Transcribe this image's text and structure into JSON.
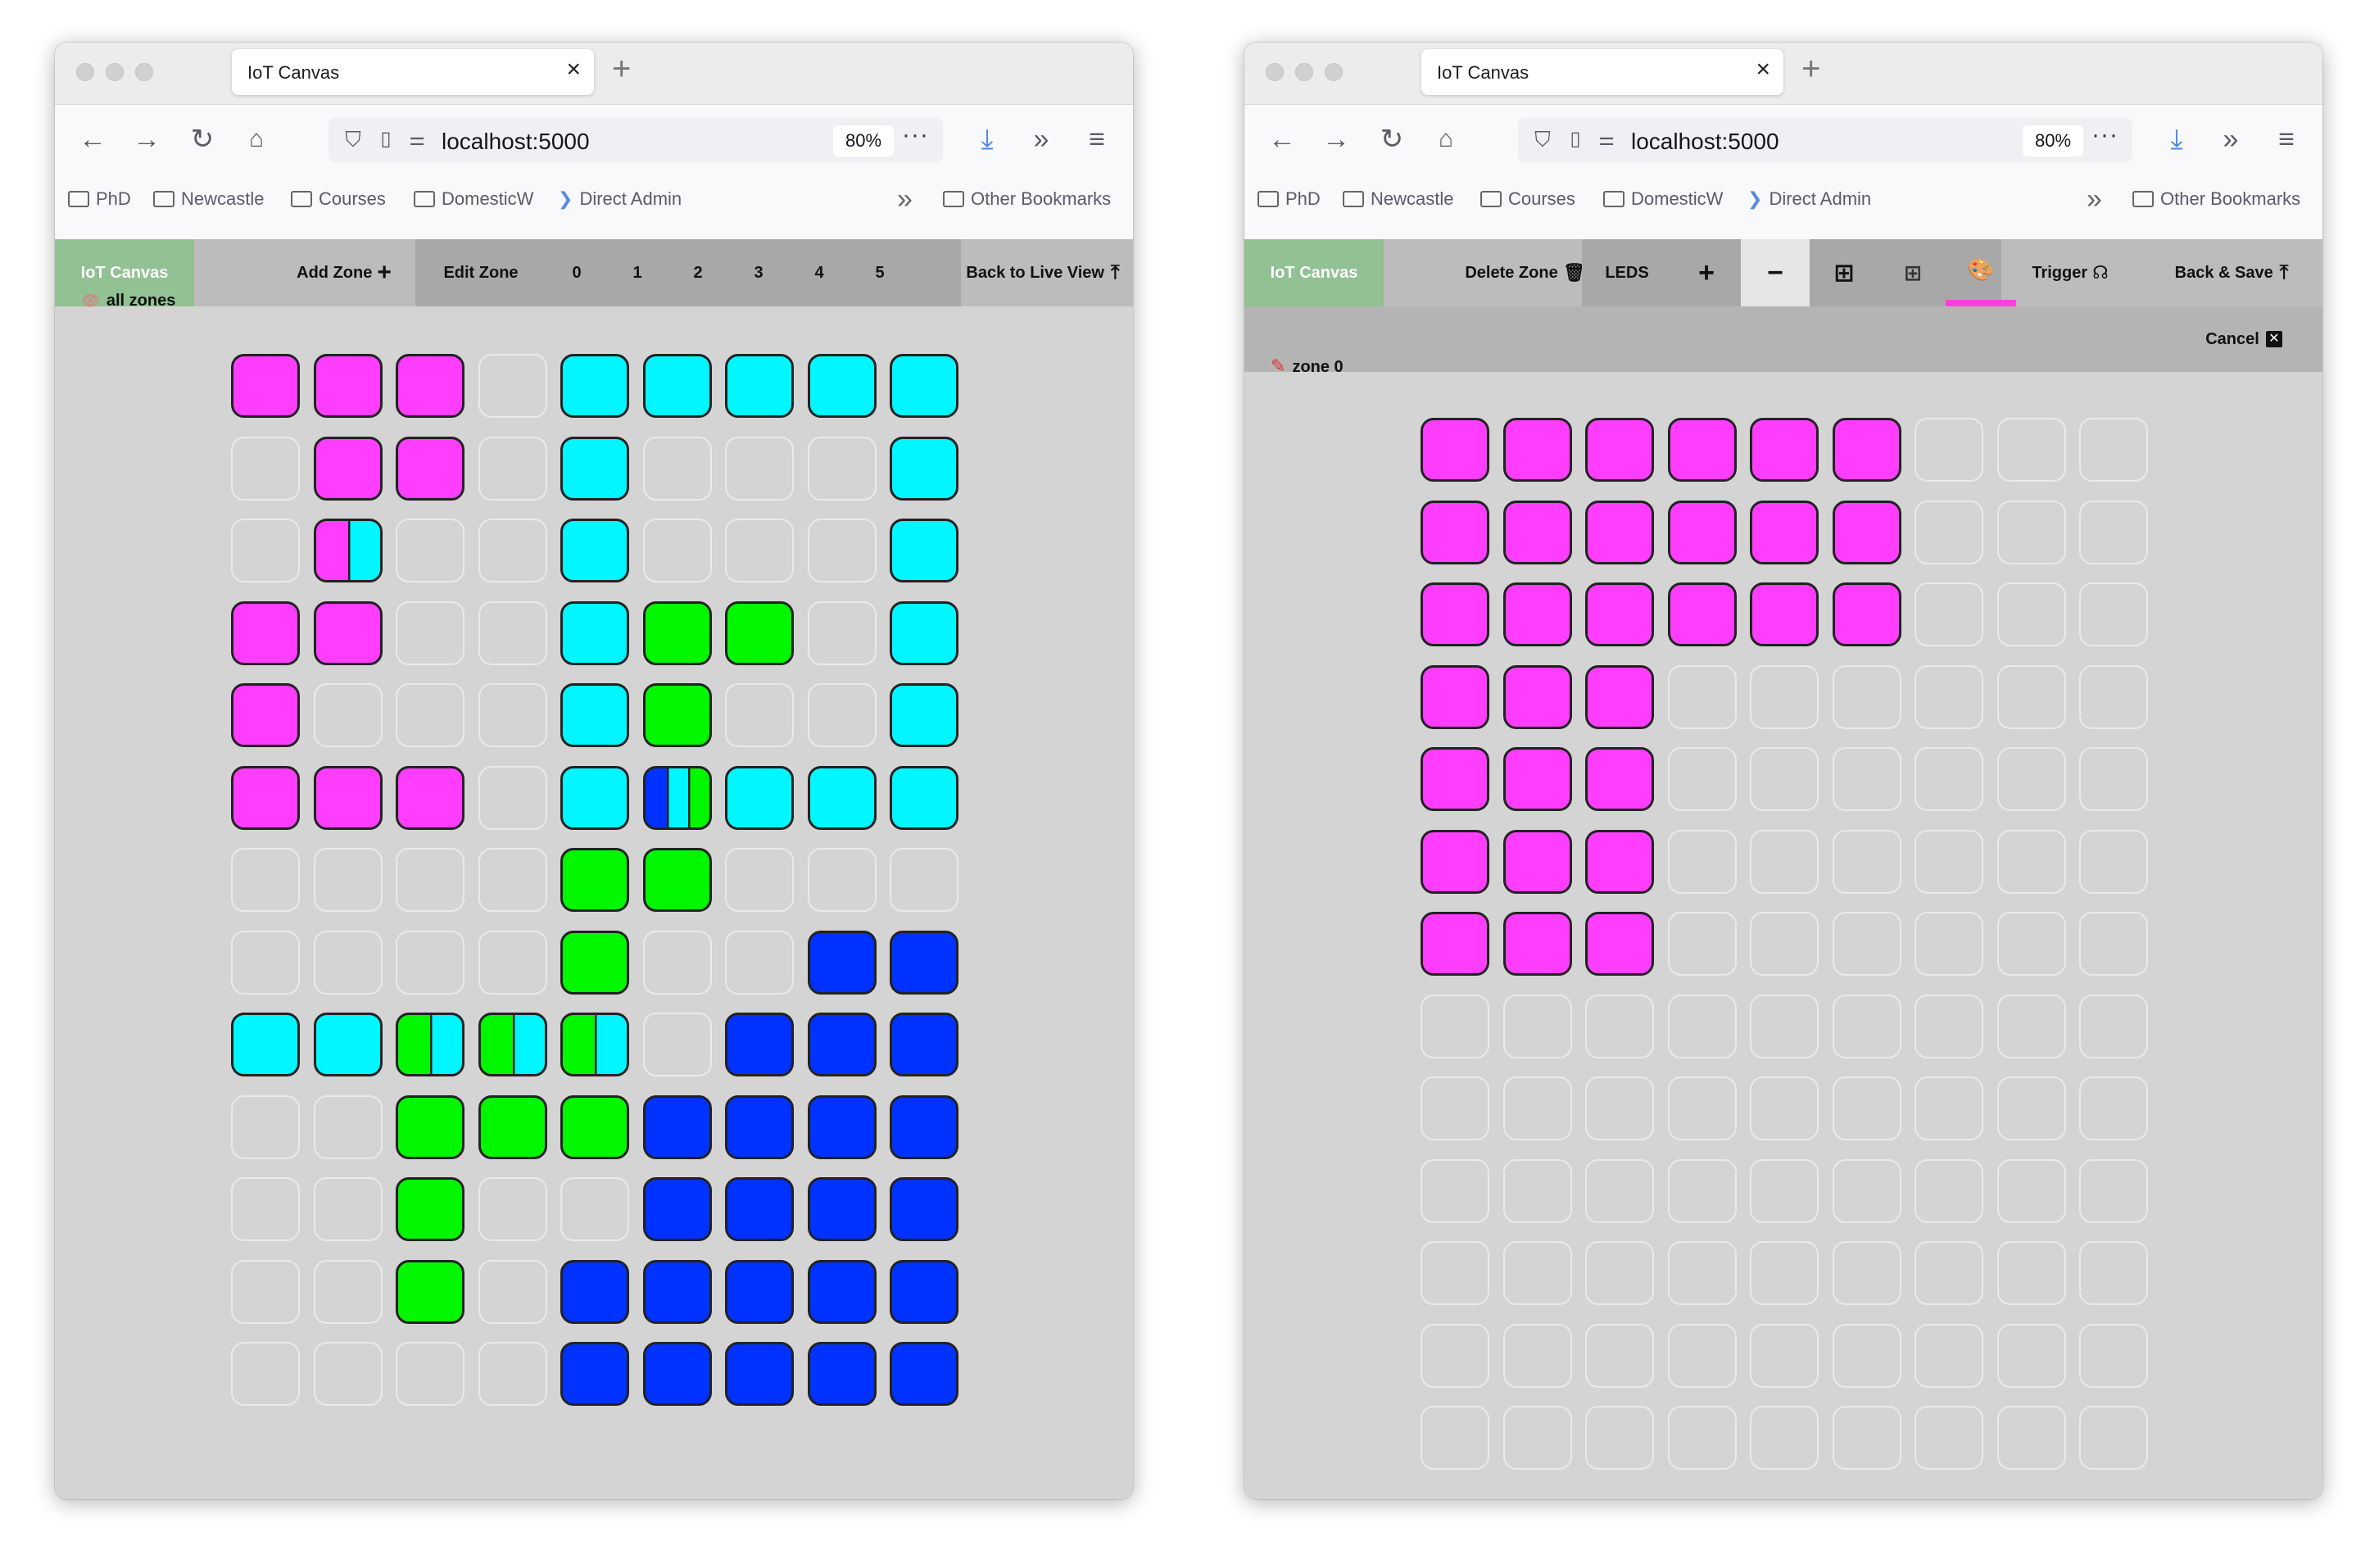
{
  "colors": {
    "M": "#ff3dff",
    "C": "#00f7ff",
    "G": "#00f700",
    "B": "#0032ff",
    "E": "#d4d4d4",
    "accent": "#ff3fd9",
    "brand": "#92c193"
  },
  "left": {
    "browser": {
      "tab_title": "IoT Canvas",
      "url": "localhost:5000",
      "zoom": "80%",
      "bookmarks": [
        "PhD",
        "Newcastle",
        "Courses",
        "DomesticW",
        "Direct Admin"
      ],
      "other_bookmarks": "Other Bookmarks"
    },
    "app": {
      "brand": "IoT Canvas",
      "add_zone": "Add Zone",
      "edit_zone": "Edit Zone",
      "zones": [
        "0",
        "1",
        "2",
        "3",
        "4",
        "5"
      ],
      "back_live": "Back to Live View"
    },
    "label": "all zones",
    "grid": [
      [
        "M",
        "M",
        "M",
        "E",
        "C",
        "C",
        "C",
        "C",
        "C"
      ],
      [
        "E",
        "M",
        "M",
        "E",
        "C",
        "E",
        "E",
        "E",
        "C"
      ],
      [
        "E",
        "MC",
        "E",
        "E",
        "C",
        "E",
        "E",
        "E",
        "C"
      ],
      [
        "M",
        "M",
        "E",
        "E",
        "C",
        "G",
        "G",
        "E",
        "C"
      ],
      [
        "M",
        "E",
        "E",
        "E",
        "C",
        "G",
        "E",
        "E",
        "C"
      ],
      [
        "M",
        "M",
        "M",
        "E",
        "C",
        "BCG",
        "C",
        "C",
        "C"
      ],
      [
        "E",
        "E",
        "E",
        "E",
        "G",
        "G",
        "E",
        "E",
        "E"
      ],
      [
        "E",
        "E",
        "E",
        "E",
        "G",
        "E",
        "E",
        "B",
        "B"
      ],
      [
        "C",
        "C",
        "GC",
        "GC",
        "GC",
        "E",
        "B",
        "B",
        "B"
      ],
      [
        "E",
        "E",
        "G",
        "G",
        "G",
        "B",
        "B",
        "B",
        "B"
      ],
      [
        "E",
        "E",
        "G",
        "E",
        "E",
        "B",
        "B",
        "B",
        "B"
      ],
      [
        "E",
        "E",
        "G",
        "E",
        "B",
        "B",
        "B",
        "B",
        "B"
      ],
      [
        "E",
        "E",
        "E",
        "E",
        "B",
        "B",
        "B",
        "B",
        "B"
      ]
    ]
  },
  "right": {
    "browser": {
      "tab_title": "IoT Canvas",
      "url": "localhost:5000",
      "zoom": "80%",
      "bookmarks": [
        "PhD",
        "Newcastle",
        "Courses",
        "DomesticW",
        "Direct Admin"
      ],
      "other_bookmarks": "Other Bookmarks"
    },
    "app": {
      "brand": "IoT Canvas",
      "delete_zone": "Delete Zone",
      "leds": "LEDS",
      "plus": "+",
      "minus": "−",
      "grid_icon": "⊞",
      "dots_icon": "⊞",
      "palette_icon": "🎨",
      "trigger": "Trigger",
      "back_save": "Back & Save",
      "cancel": "Cancel"
    },
    "label": "zone 0",
    "grid": [
      [
        "M",
        "M",
        "M",
        "M",
        "M",
        "M",
        "E",
        "E",
        "E"
      ],
      [
        "M",
        "M",
        "M",
        "M",
        "M",
        "M",
        "E",
        "E",
        "E"
      ],
      [
        "M",
        "M",
        "M",
        "M",
        "M",
        "M",
        "E",
        "E",
        "E"
      ],
      [
        "M",
        "M",
        "M",
        "E",
        "E",
        "E",
        "E",
        "E",
        "E"
      ],
      [
        "M",
        "M",
        "M",
        "E",
        "E",
        "E",
        "E",
        "E",
        "E"
      ],
      [
        "M",
        "M",
        "M",
        "E",
        "E",
        "E",
        "E",
        "E",
        "E"
      ],
      [
        "M",
        "M",
        "M",
        "E",
        "E",
        "E",
        "E",
        "E",
        "E"
      ],
      [
        "E",
        "E",
        "E",
        "E",
        "E",
        "E",
        "E",
        "E",
        "E"
      ],
      [
        "E",
        "E",
        "E",
        "E",
        "E",
        "E",
        "E",
        "E",
        "E"
      ],
      [
        "E",
        "E",
        "E",
        "E",
        "E",
        "E",
        "E",
        "E",
        "E"
      ],
      [
        "E",
        "E",
        "E",
        "E",
        "E",
        "E",
        "E",
        "E",
        "E"
      ],
      [
        "E",
        "E",
        "E",
        "E",
        "E",
        "E",
        "E",
        "E",
        "E"
      ],
      [
        "E",
        "E",
        "E",
        "E",
        "E",
        "E",
        "E",
        "E",
        "E"
      ]
    ]
  }
}
